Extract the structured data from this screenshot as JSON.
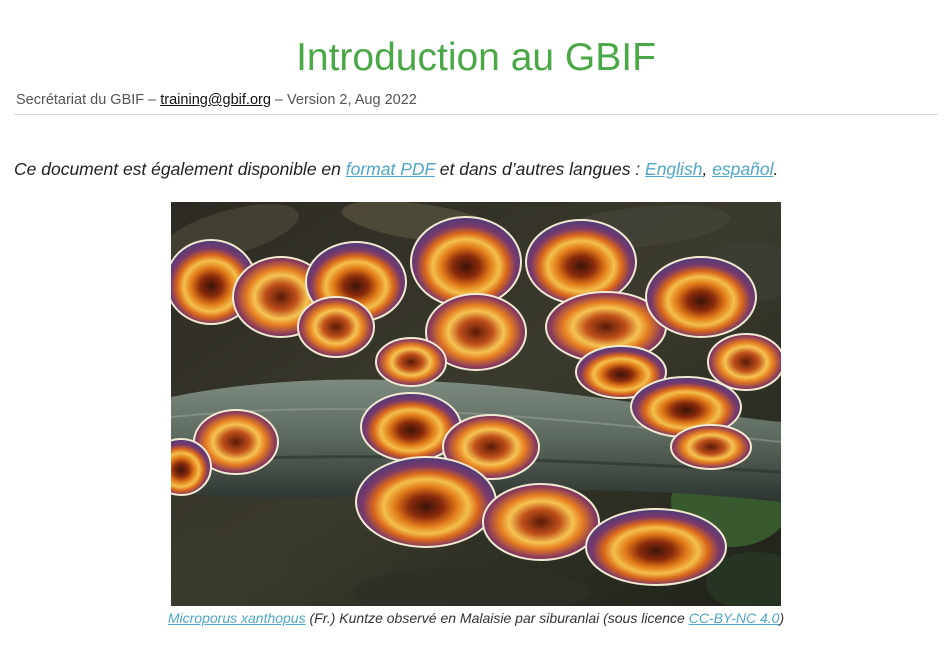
{
  "title": "Introduction au GBIF",
  "byline": {
    "prefix": "Secrétariat du GBIF – ",
    "email": "training@gbif.org",
    "suffix": " – Version 2, Aug 2022"
  },
  "availability": {
    "text1": "Ce document est également disponible en ",
    "pdf_link": "format PDF",
    "text2": " et dans d’autres langues : ",
    "lang1": "English",
    "sep": ",",
    "lang2": "español",
    "end": "."
  },
  "figure": {
    "image_subject": "bracket-fungi-on-log",
    "caption_link": "Microporus xanthopus",
    "caption_text": " (Fr.) Kuntze observé en Malaisie par siburanlai (sous licence ",
    "license_link": "CC-BY-NC 4.0",
    "caption_end": ")"
  },
  "colors": {
    "title": "#4aa847",
    "link": "#4fa6c9"
  }
}
